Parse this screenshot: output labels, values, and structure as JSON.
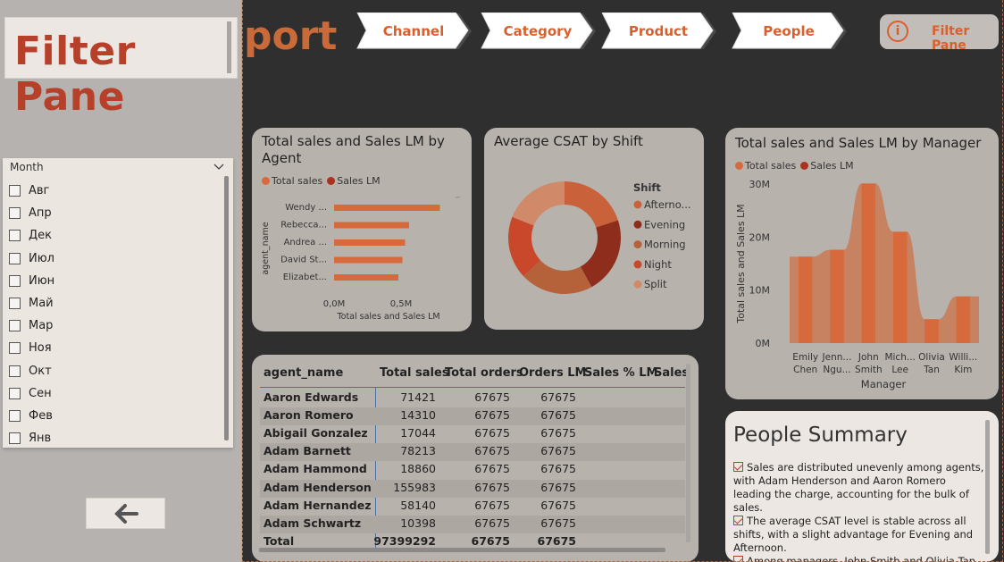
{
  "filter_pane": {
    "title": "Filter Pane",
    "slicer": {
      "label": "Month",
      "items": [
        "Авг",
        "Апр",
        "Дек",
        "Июл",
        "Июн",
        "Май",
        "Мар",
        "Ноя",
        "Окт",
        "Сен",
        "Фев",
        "Янв"
      ]
    },
    "back_icon": "arrow-left-icon"
  },
  "header": {
    "title_partial": "port",
    "nav": [
      "Channel",
      "Category",
      "Product",
      "People"
    ],
    "filter_button": {
      "label": "Filter Pane",
      "icon": "info-icon"
    }
  },
  "colors": {
    "accent": "#d8602f",
    "brand_red": "#b7402a",
    "bar": "#d66a3c",
    "sales_lm": "#a8341f"
  },
  "chart_data": [
    {
      "type": "bar",
      "title": "Total sales and Sales LM by Agent",
      "legend": [
        "Total sales",
        "Sales LM"
      ],
      "categories": [
        "Wendy ...",
        "Rebecca...",
        "Andrea ...",
        "David St...",
        "Elizabet..."
      ],
      "series": [
        {
          "name": "Total sales",
          "values": [
            0.79,
            0.56,
            0.53,
            0.51,
            0.48
          ]
        }
      ],
      "ticks": [
        "0,0M",
        "0,5M"
      ],
      "xlabel": "Total sales and Sales LM",
      "ylabel": "agent_name",
      "xlim": [
        0,
        0.9
      ]
    },
    {
      "type": "pie",
      "title": "Average CSAT by Shift",
      "legend_title": "Shift",
      "categories": [
        "Afterno...",
        "Evening",
        "Morning",
        "Night",
        "Split"
      ],
      "values": [
        20,
        22,
        21,
        18,
        19
      ],
      "colors": [
        "#c9623a",
        "#8e2d1c",
        "#b5613a",
        "#c9482c",
        "#d08a6a"
      ]
    },
    {
      "type": "area",
      "title": "Total sales and Sales LM by Manager",
      "legend": [
        "Total sales",
        "Sales LM"
      ],
      "categories": [
        "Emily Chen",
        "Jenn... Ngu...",
        "John Smith",
        "Mich... Lee",
        "Olivia Tan",
        "Willi... Kim"
      ],
      "cat_lines": [
        [
          "Emily",
          "Chen"
        ],
        [
          "Jenn...",
          "Ngu..."
        ],
        [
          "John",
          "Smith"
        ],
        [
          "Mich...",
          "Lee"
        ],
        [
          "Olivia",
          "Tan"
        ],
        [
          "Willi...",
          "Kim"
        ]
      ],
      "series": [
        {
          "name": "Total sales",
          "values": [
            16.3,
            17.6,
            30.1,
            21,
            4.5,
            8.8
          ]
        }
      ],
      "ticks": [
        "0M",
        "10M",
        "20M",
        "30M"
      ],
      "ylim": [
        0,
        30
      ],
      "xlabel": "Manager",
      "ylabel": "Total sales and Sales LM"
    }
  ],
  "table": {
    "headers": [
      "agent_name",
      "Total sales",
      "Total orders",
      "Orders LM",
      "Sales % LM",
      "Sales"
    ],
    "rows": [
      [
        "Aaron Edwards",
        "71421",
        "67675",
        "67675"
      ],
      [
        "Aaron Romero",
        "14310",
        "67675",
        "67675"
      ],
      [
        "Abigail Gonzalez",
        "17044",
        "67675",
        "67675"
      ],
      [
        "Adam Barnett",
        "78213",
        "67675",
        "67675"
      ],
      [
        "Adam Hammond",
        "18860",
        "67675",
        "67675"
      ],
      [
        "Adam Henderson",
        "155983",
        "67675",
        "67675"
      ],
      [
        "Adam Hernandez",
        "58140",
        "67675",
        "67675"
      ],
      [
        "Adam Schwartz",
        "10398",
        "67675",
        "67675"
      ]
    ],
    "total": [
      "Total",
      "97399292",
      "67675",
      "67675"
    ]
  },
  "summary": {
    "title": "People Summary",
    "points": [
      "Sales are distributed unevenly among agents, with Adam Henderson and Aaron Romero leading the charge, accounting for the bulk of sales.",
      "The average CSAT level is stable across all shifts, with a slight advantage for Evening and Afternoon.",
      "Among managers, John Smith and Olivia Tan have the best sales results."
    ]
  }
}
